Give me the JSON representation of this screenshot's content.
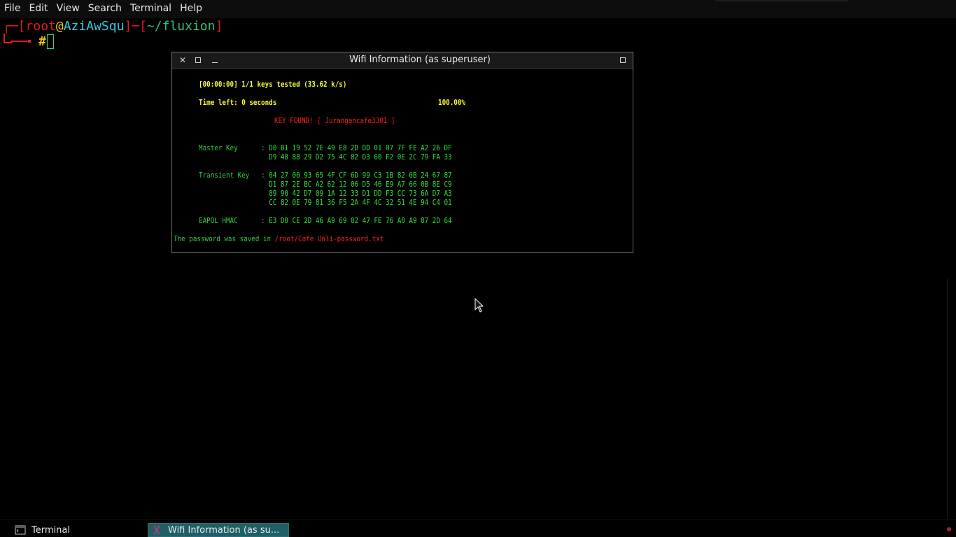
{
  "menubar": {
    "items": [
      "File",
      "Edit",
      "View",
      "Search",
      "Terminal",
      "Help"
    ]
  },
  "prompt": {
    "bracket_open": "┌─[",
    "user": "root",
    "at": "@",
    "host": "AziAwSqu",
    "separator": "]─[",
    "path": "~/fluxion",
    "bracket_close": "]",
    "symbol": "#"
  },
  "popup": {
    "title": "Wifi Information (as superuser)",
    "progress_line": "[00:00:00] 1/1 keys tested (33.62 k/s)",
    "time_left": "Time left: 0 seconds",
    "percent": "100.00%",
    "key_found": "KEY FOUND! [ Jurangancafe3301 ]",
    "master_key_label": "Master Key",
    "master_key_lines": [
      ": D0 B1 19 52 7E 49 E8 2D DD 01 07 7F FE A2 26 DF",
      "  D9 48 88 29 D2 75 4C 82 D3 60 F2 0E 2C 79 FA 33"
    ],
    "transient_key_label": "Transient Key",
    "transient_key_lines": [
      ": 04 27 00 93 65 4F CF 6D 99 C3 1B 82 0B 24 67 87",
      "  D1 87 2E BC A2 62 12 06 D5 46 E9 A7 66 0B 8E C9",
      "  89 90 42 D7 09 1A 12 33 D1 DD F3 CC 73 6A D7 A3",
      "  CC 82 0E 79 81 36 F5 2A 4F 4C 32 51 4E 94 C4 01"
    ],
    "eapol_label": "EAPOL HMAC",
    "eapol_line": ": E3 D0 CE 2D 46 A9 69 02 47 FE 76 A0 A9 87 2D 64",
    "saved_prefix": "The password was saved in ",
    "saved_path": "/root/Cafe Unli-password.txt"
  },
  "taskbar": {
    "items": [
      {
        "label": "Terminal",
        "icon": "terminal-icon"
      },
      {
        "label": "Wifi Information (as su...",
        "icon": "fluxion-icon"
      }
    ]
  },
  "colors": {
    "accent_task": "#1f5f66",
    "prompt_red": "#e01b24",
    "prompt_cyan": "#33c7de",
    "prompt_green": "#2ec27e",
    "output_yellow": "#f8f835",
    "output_green": "#33e03a",
    "output_red": "#ff1e1e"
  }
}
